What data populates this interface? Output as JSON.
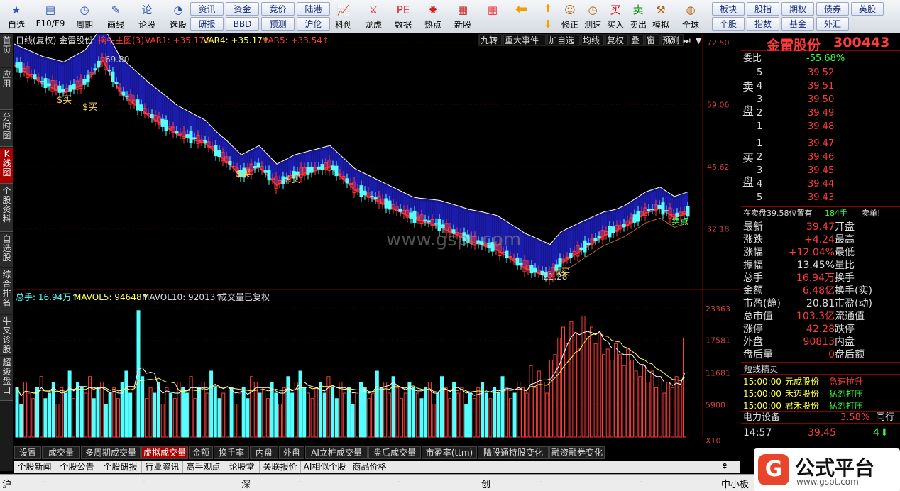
{
  "toolbar": {
    "items": [
      {
        "label": "自选",
        "icon": "star-icon"
      },
      {
        "label": "F10/F9",
        "icon": "info-window-icon"
      },
      {
        "label": "周期",
        "icon": "clock-icon"
      },
      {
        "label": "画线",
        "icon": "pencil-icon"
      },
      {
        "label": "论股",
        "icon": "talk-icon"
      },
      {
        "label": "选股",
        "icon": "chart-search-icon"
      }
    ],
    "grid1": [
      "资讯",
      "资金",
      "竞价",
      "陆港",
      "研报",
      "BBD",
      "预测",
      "沪伦"
    ],
    "items2": [
      {
        "label": "科创",
        "icon": "chart-icon"
      },
      {
        "label": "龙虎",
        "icon": "dragon-icon"
      },
      {
        "label": "数据",
        "icon": "pe-icon"
      },
      {
        "label": "热点",
        "icon": "hot-icon"
      },
      {
        "label": "新股",
        "icon": "ipo-icon"
      }
    ],
    "items3": [
      {
        "label": "修正",
        "icon": "smile-icon"
      },
      {
        "label": "测速",
        "icon": "clock-icon"
      },
      {
        "label": "买入",
        "icon": "buy-icon",
        "glyph": "买"
      },
      {
        "label": "卖出",
        "icon": "sell-icon",
        "glyph": "卖"
      },
      {
        "label": "模拟",
        "icon": "hammer-icon"
      },
      {
        "label": "全球",
        "icon": "globe-icon"
      }
    ],
    "grid2": [
      "板块",
      "股指",
      "期权",
      "债券",
      "英股",
      "个股",
      "指数",
      "基金",
      "外汇"
    ]
  },
  "left_tabs": [
    "首页",
    "应用",
    "分时图",
    "K线图",
    "个股资料",
    "自选股",
    "综合排名",
    "牛叉诊股",
    "超级盘口"
  ],
  "chart": {
    "title_text": "日线(复权) 金雷股份",
    "indicator": "擒牛主图(3)",
    "var1": "VAR1: +35.17↑",
    "var4": "VAR4: +35.17↑",
    "var5": "VAR5: +33.54↑",
    "tools": [
      "九转",
      "重大事件",
      "加自选",
      "均线",
      "复权",
      "叠",
      "窗",
      "预测"
    ],
    "price_axis": [
      "72.50",
      "59.06",
      "45.62",
      "32.18"
    ],
    "high_label": "69.80",
    "low_label": "21.28",
    "buy_label": "$买",
    "sell_point": "卖点",
    "watermark": "www.gspt.com",
    "vol_header": {
      "total": "总手: 16.94万↑",
      "ma5": "MAVOL5: 94648↑",
      "ma10": "MAVOL10: 92013↑",
      "note": "成交量已复权"
    },
    "vol_axis": [
      "23363",
      "17581",
      "11681",
      "5900"
    ],
    "vol_unit": "X10",
    "volumes": [
      9,
      6,
      10,
      8,
      7,
      9,
      11,
      7,
      8,
      10,
      6,
      9,
      8,
      12,
      7,
      10,
      9,
      8,
      11,
      7,
      9,
      10,
      6,
      8,
      9,
      7,
      10,
      12,
      8,
      9,
      23,
      11,
      7,
      9,
      8,
      10,
      6,
      9,
      8,
      7,
      10,
      9,
      8,
      11,
      7,
      9,
      10,
      8,
      12,
      9,
      7,
      8,
      10,
      9,
      6,
      8,
      9,
      7,
      11,
      10,
      8,
      9,
      7,
      10,
      8,
      6,
      9,
      11,
      8,
      10,
      12,
      9,
      8,
      7,
      9,
      10,
      8,
      11,
      9,
      7,
      10,
      8,
      9,
      6,
      8,
      10,
      9,
      7,
      8,
      12,
      9,
      10,
      8,
      11,
      9,
      7,
      8,
      10,
      9,
      8,
      7,
      9,
      10,
      6,
      8,
      11,
      9,
      7,
      10,
      8,
      9,
      6,
      8,
      7,
      9,
      10,
      8,
      7,
      9,
      8,
      11,
      9,
      7,
      8,
      10,
      9,
      8,
      13,
      9,
      12,
      10,
      8,
      14,
      15,
      18,
      20,
      17,
      21,
      19,
      16,
      22,
      18,
      20,
      17,
      19,
      15,
      16,
      14,
      17,
      15,
      13,
      16,
      14,
      12,
      11,
      13,
      10,
      12,
      9,
      11,
      8,
      10,
      9,
      11,
      10,
      18
    ]
  },
  "bottom_tabs": [
    "设置",
    "成交量",
    "多周期成交量",
    "虚拟成交量",
    "金额",
    "换手率",
    "内盘",
    "外盘",
    "AI立桩成交量",
    "盘后成交量",
    "市盈率(ttm)",
    "陆股通持股变化",
    "融资融券变化"
  ],
  "news_tabs": [
    "个股新闻",
    "个股公告",
    "个股研报",
    "行业资讯",
    "高手观点",
    "论股堂",
    "关联报价",
    "AI相似个股",
    "商品价格"
  ],
  "panel": {
    "name": "金雷股份",
    "code": "300443",
    "weibi_label": "委比",
    "weibi": "-55.68%",
    "sell_label": "卖盘",
    "buy_label": "买盘",
    "asks": [
      {
        "n": "5",
        "p": "39.52"
      },
      {
        "n": "4",
        "p": "39.51"
      },
      {
        "n": "3",
        "p": "39.50"
      },
      {
        "n": "2",
        "p": "39.49"
      },
      {
        "n": "1",
        "p": "39.48"
      }
    ],
    "bids": [
      {
        "n": "1",
        "p": "39.47"
      },
      {
        "n": "2",
        "p": "39.46"
      },
      {
        "n": "3",
        "p": "39.45"
      },
      {
        "n": "4",
        "p": "39.44"
      },
      {
        "n": "5",
        "p": "39.43"
      }
    ],
    "status": "在卖盘39.58位置有",
    "status_qty": "184手",
    "status_tail": "卖单!",
    "stats": [
      {
        "k": "最新",
        "v": "39.47",
        "k2": "开盘"
      },
      {
        "k": "涨跌",
        "v": "+4.24",
        "k2": "最高"
      },
      {
        "k": "涨幅",
        "v": "+12.04%",
        "k2": "最低"
      },
      {
        "k": "振幅",
        "v": "13.45%",
        "k2": "量比"
      },
      {
        "k": "总手",
        "v": "16.94万",
        "k2": "换手"
      },
      {
        "k": "金额",
        "v": "6.48亿",
        "k2": "换手(实)"
      },
      {
        "k": "市盈(静)",
        "v": "20.81",
        "k2": "市盈(动)"
      },
      {
        "k": "总市值",
        "v": "103.3亿",
        "k2": "流通值"
      },
      {
        "k": "涨停",
        "v": "42.28",
        "k2": "跌停"
      },
      {
        "k": "外盘",
        "v": "90813",
        "k2": "内盘"
      },
      {
        "k": "盘后量",
        "v": "0",
        "k2": "盘后额"
      }
    ],
    "short_title": "短线精灵",
    "short": [
      {
        "t": "15:00:00",
        "n": "元成股份",
        "e": "急速拉升"
      },
      {
        "t": "15:00:00",
        "n": "禾迈股份",
        "e": "猛烈打压"
      },
      {
        "t": "15:00:00",
        "n": "君禾股份",
        "e": "猛烈打压"
      }
    ],
    "sector": "电力设备",
    "sector_pct": "3.58%",
    "sector_tail": "同行",
    "tick_time": "14:57",
    "tick_price": "39.45",
    "tick_vol": "4"
  },
  "status": {
    "sh": "沪",
    "sz": "深",
    "cy": "创",
    "zx": "中小板",
    "brand": "公式平台",
    "brand_url": "www.gspt.com",
    "dash": "-"
  },
  "colors": {
    "up": "#ff3c3c",
    "down": "#54ffff",
    "band": "#1a1aa8"
  }
}
